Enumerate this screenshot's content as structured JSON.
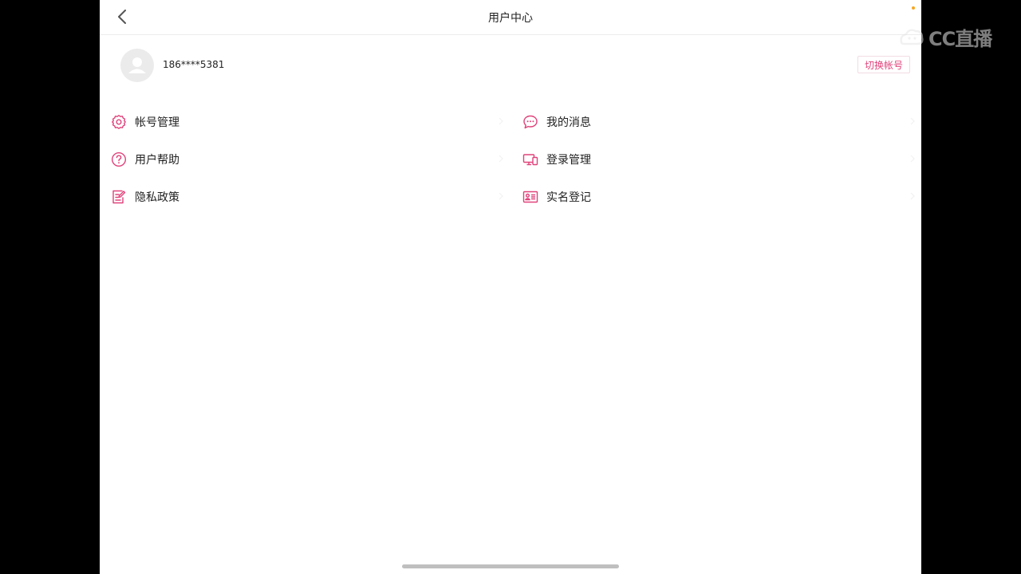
{
  "header": {
    "title": "用户中心"
  },
  "profile": {
    "username": "186****5381",
    "switch_account_label": "切换帐号"
  },
  "menu": {
    "left": [
      {
        "label": "帐号管理",
        "icon": "gear-icon"
      },
      {
        "label": "用户帮助",
        "icon": "question-circle-icon"
      },
      {
        "label": "隐私政策",
        "icon": "edit-document-icon"
      }
    ],
    "right": [
      {
        "label": "我的消息",
        "icon": "chat-bubble-icon"
      },
      {
        "label": "登录管理",
        "icon": "devices-icon"
      },
      {
        "label": "实名登记",
        "icon": "id-card-icon"
      }
    ]
  },
  "watermark": {
    "text": "CC直播"
  },
  "colors": {
    "accent": "#e0427a",
    "background": "#ffffff",
    "letterbox": "#000000"
  }
}
